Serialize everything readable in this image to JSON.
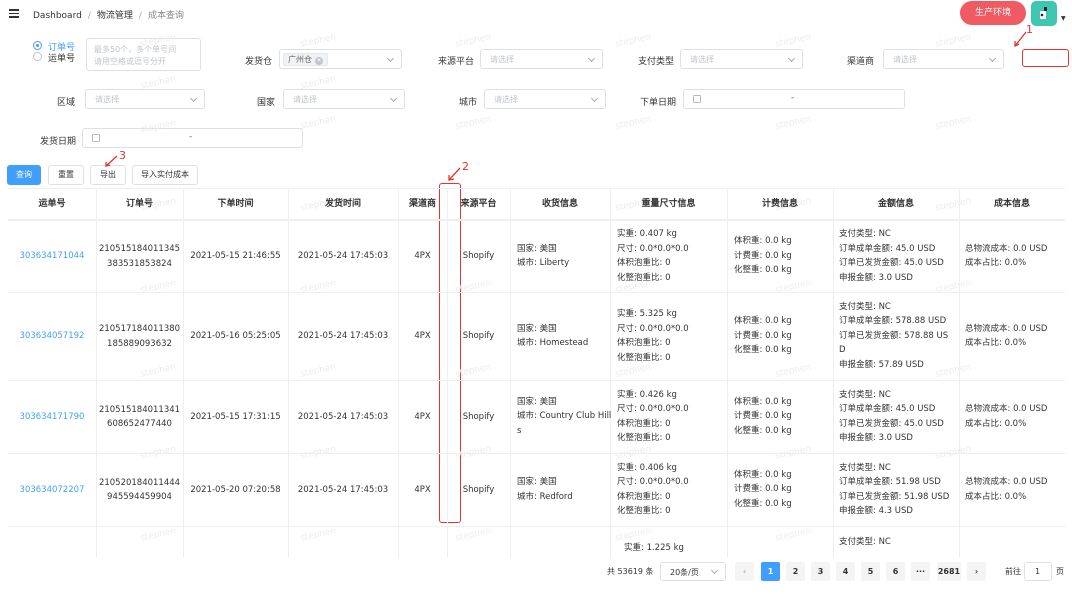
{
  "breadcrumb": {
    "items": [
      "Dashboard",
      "物流管理",
      "成本查询"
    ]
  },
  "header": {
    "env_button": "生产环境"
  },
  "filters": {
    "search_type": {
      "opt1": "订单号",
      "opt2": "运单号"
    },
    "order_textarea": {
      "line1": "最多50个，多个单号间",
      "line2": "请用空格或逗号分开"
    },
    "warehouse": {
      "label": "发货仓",
      "tag": "广州仓"
    },
    "source": {
      "label": "来源平台",
      "placeholder": "请选择"
    },
    "pay_type": {
      "label": "支付类型",
      "placeholder": "请选择"
    },
    "carrier": {
      "label": "渠道商",
      "placeholder": "请选择"
    },
    "region": {
      "label": "区域",
      "placeholder": "请选择"
    },
    "country": {
      "label": "国家",
      "placeholder": "请选择"
    },
    "city": {
      "label": "城市",
      "placeholder": "请选择"
    },
    "order_date": {
      "label": "下单日期",
      "sep": "-"
    },
    "ship_date": {
      "label": "发货日期",
      "sep": "-"
    }
  },
  "actions": {
    "query": "查询",
    "reset": "重置",
    "export": "导出",
    "import": "导入实付成本"
  },
  "annotations": {
    "a1": "1",
    "a2": "2",
    "a3": "3"
  },
  "watermark": "stephen",
  "table": {
    "columns": [
      "运单号",
      "订单号",
      "下单时间",
      "发货时间",
      "渠道商",
      "来源平台",
      "收货信息",
      "重量尺寸信息",
      "计费信息",
      "金额信息",
      "成本信息"
    ],
    "rows": [
      {
        "waybill": "303634171044",
        "order1": "210515184011345",
        "order2": "383531853824",
        "order_time": "2021-05-15 21:46:55",
        "ship_time": "2021-05-24 17:45:03",
        "carrier": "4PX",
        "platform": "Shopify",
        "recv": [
          "国家: 美国",
          "城市:  Liberty"
        ],
        "weight": [
          "实重: 0.407 kg",
          "尺寸: 0.0*0.0*0.0",
          "体积泡重比:  0",
          "化整泡重比:  0"
        ],
        "billing": [
          "体积重: 0.0 kg",
          "计费重: 0.0 kg",
          "化整重:  0.0 kg"
        ],
        "amount": [
          "支付类型: NC",
          "订单成单金额: 45.0 USD",
          "订单已发货金额: 45.0 USD",
          "申报金额:  3.0 USD"
        ],
        "cost": [
          "总物流成本: 0.0 USD",
          "成本占比: 0.0%"
        ]
      },
      {
        "waybill": "303634057192",
        "order1": "210517184011380",
        "order2": "185889093632",
        "order_time": "2021-05-16 05:25:05",
        "ship_time": "2021-05-24 17:45:03",
        "carrier": "4PX",
        "platform": "Shopify",
        "recv": [
          "国家: 美国",
          "城市:  Homestead"
        ],
        "weight": [
          "实重: 5.325 kg",
          "尺寸: 0.0*0.0*0.0",
          "体积泡重比:  0",
          "化整泡重比:  0"
        ],
        "billing": [
          "体积重: 0.0 kg",
          "计费重: 0.0 kg",
          "化整重:  0.0 kg"
        ],
        "amount": [
          "支付类型: NC",
          "订单成单金额: 578.88 USD",
          "订单已发货金额: 578.88 US",
          "D",
          "申报金额:  57.89 USD"
        ],
        "cost": [
          "总物流成本: 0.0 USD",
          "成本占比: 0.0%"
        ]
      },
      {
        "waybill": "303634171790",
        "order1": "210515184011341",
        "order2": "608652477440",
        "order_time": "2021-05-15 17:31:15",
        "ship_time": "2021-05-24 17:45:03",
        "carrier": "4PX",
        "platform": "Shopify",
        "recv": [
          "国家: 美国",
          "城市:  Country Club Hill",
          "s"
        ],
        "weight": [
          "实重: 0.426 kg",
          "尺寸: 0.0*0.0*0.0",
          "体积泡重比:  0",
          "化整泡重比:  0"
        ],
        "billing": [
          "体积重: 0.0 kg",
          "计费重: 0.0 kg",
          "化整重:  0.0 kg"
        ],
        "amount": [
          "支付类型: NC",
          "订单成单金额: 45.0 USD",
          "订单已发货金额: 45.0 USD",
          "申报金额:  3.0 USD"
        ],
        "cost": [
          "总物流成本: 0.0 USD",
          "成本占比: 0.0%"
        ]
      },
      {
        "waybill": "303634072207",
        "order1": "210520184011444",
        "order2": "945594459904",
        "order_time": "2021-05-20 07:20:58",
        "ship_time": "2021-05-24 17:45:03",
        "carrier": "4PX",
        "platform": "Shopify",
        "recv": [
          "国家: 美国",
          "城市:  Redford"
        ],
        "weight": [
          "实重: 0.406 kg",
          "尺寸: 0.0*0.0*0.0",
          "体积泡重比:  0",
          "化整泡重比:  0"
        ],
        "billing": [
          "体积重: 0.0 kg",
          "计费重: 0.0 kg",
          "化整重:  0.0 kg"
        ],
        "amount": [
          "支付类型: NC",
          "订单成单金额: 51.98 USD",
          "订单已发货金额: 51.98 USD",
          "申报金额:  4.3 USD"
        ],
        "cost": [
          "总物流成本: 0.0 USD",
          "成本占比: 0.0%"
        ]
      }
    ],
    "partial_row": {
      "weight": "实重: 1.225 kg",
      "amount": "支付类型: NC"
    }
  },
  "pagination": {
    "total": "共 53619 条",
    "page_size": "20条/页",
    "pages": [
      "1",
      "2",
      "3",
      "4",
      "5",
      "6",
      "···",
      "2681"
    ],
    "goto_label": "前往",
    "goto_value": "1",
    "goto_suffix": "页"
  }
}
